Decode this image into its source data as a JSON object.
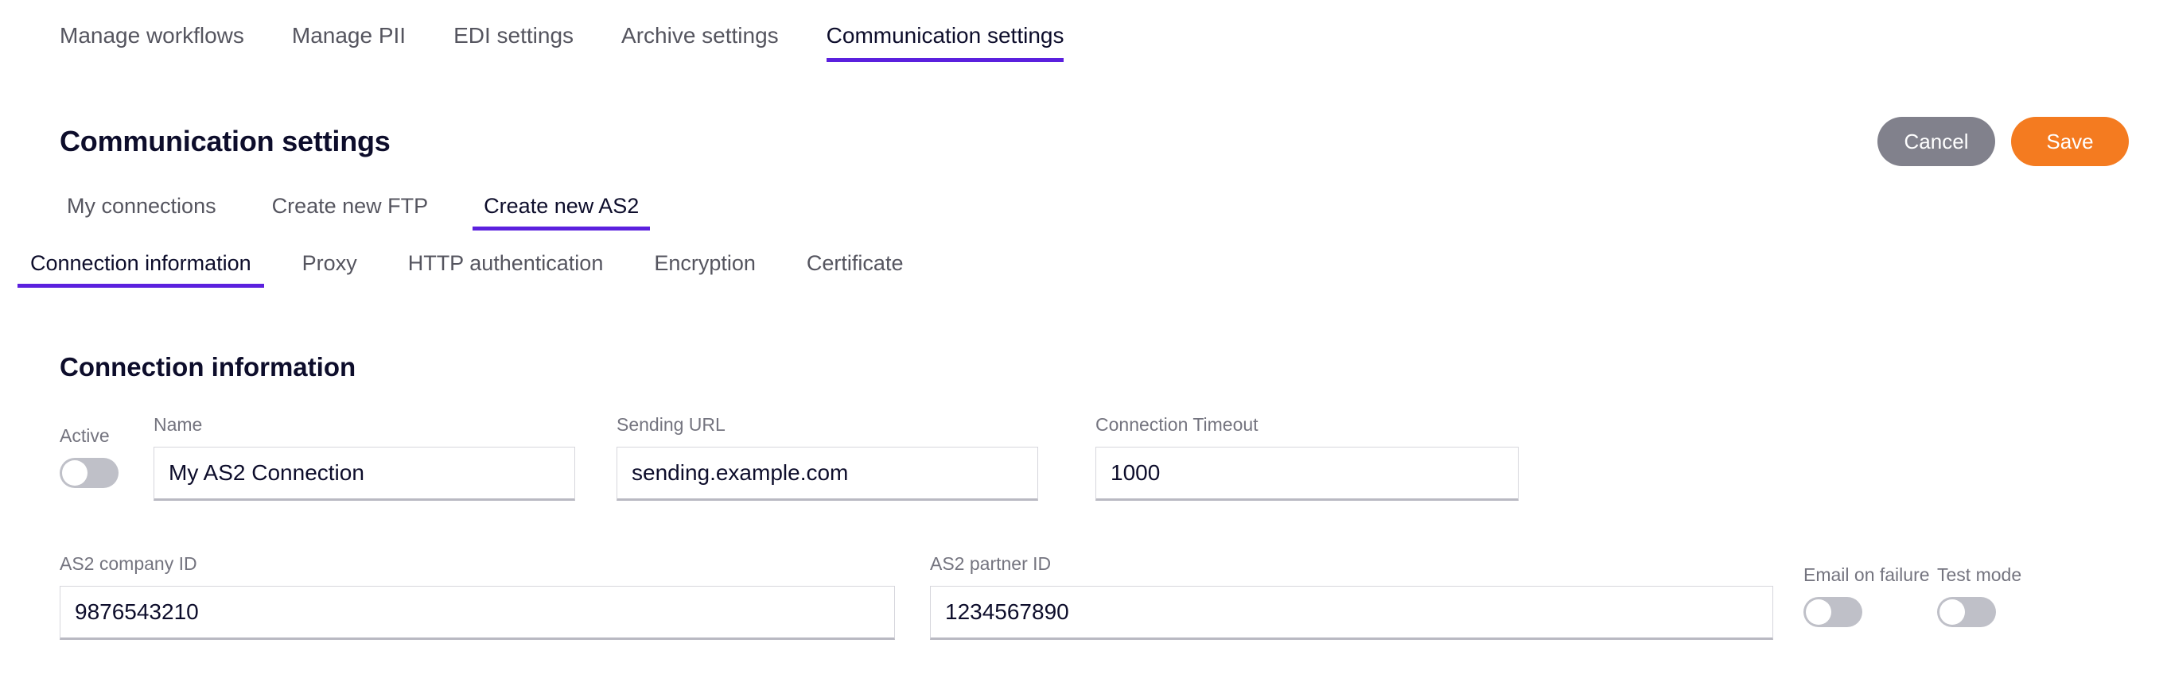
{
  "top_tabs": [
    {
      "label": "Manage workflows",
      "active": false
    },
    {
      "label": "Manage PII",
      "active": false
    },
    {
      "label": "EDI settings",
      "active": false
    },
    {
      "label": "Archive settings",
      "active": false
    },
    {
      "label": "Communication settings",
      "active": true
    }
  ],
  "header": {
    "title": "Communication settings",
    "cancel_label": "Cancel",
    "save_label": "Save"
  },
  "sub_tabs": [
    {
      "label": "My connections",
      "active": false
    },
    {
      "label": "Create new FTP",
      "active": false
    },
    {
      "label": "Create new AS2",
      "active": true
    }
  ],
  "leaf_tabs": [
    {
      "label": "Connection information",
      "active": true
    },
    {
      "label": "Proxy",
      "active": false
    },
    {
      "label": "HTTP authentication",
      "active": false
    },
    {
      "label": "Encryption",
      "active": false
    },
    {
      "label": "Certificate",
      "active": false
    }
  ],
  "section": {
    "heading": "Connection information"
  },
  "fields": {
    "active": {
      "label": "Active",
      "value": "off"
    },
    "name": {
      "label": "Name",
      "value": "My AS2 Connection",
      "placeholder": "Name"
    },
    "sending_url": {
      "label": "Sending URL",
      "value": "sending.example.com",
      "placeholder": "Sending URL"
    },
    "connection_timeout": {
      "label": "Connection Timeout",
      "value": "1000",
      "placeholder": "Connection Timeout"
    },
    "as2_company_id": {
      "label": "AS2 company ID",
      "value": "9876543210",
      "placeholder": "AS2 company ID"
    },
    "as2_partner_id": {
      "label": "AS2 partner ID",
      "value": "1234567890",
      "placeholder": "AS2 partner ID"
    },
    "email_on_failure": {
      "label": "Email on failure",
      "value": "off"
    },
    "test_mode": {
      "label": "Test mode",
      "value": "off"
    }
  },
  "colors": {
    "accent_purple": "#5B20DE",
    "save_orange": "#F47B20",
    "cancel_gray": "#81818C",
    "text_ink": "#0D0D2B",
    "label_gray": "#74747F",
    "toggle_track": "#BFC0C8",
    "field_border": "#D6D6DC"
  }
}
